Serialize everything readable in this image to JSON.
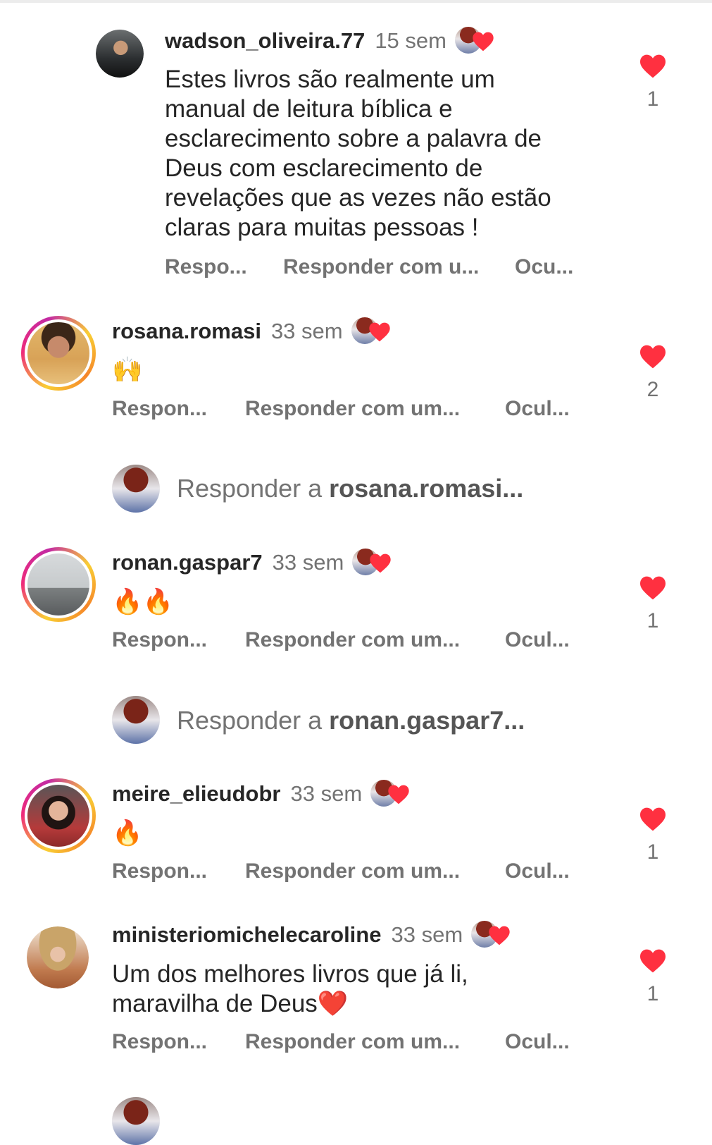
{
  "comments": [
    {
      "username": "wadson_oliveira.77",
      "time": "15 sem",
      "text_lines": [
        "Estes livros são realmente um",
        "manual de leitura bíblica e",
        "esclarecimento sobre a palavra de",
        "Deus com esclarecimento de",
        "revelações que as vezes não estão",
        "claras para muitas pessoas !"
      ],
      "actions": [
        "Respo...",
        "Responder com u...",
        "Ocu..."
      ],
      "likes": "1"
    },
    {
      "username": "rosana.romasi",
      "time": "33 sem",
      "text": "🙌",
      "actions": [
        "Respon...",
        "Responder com um...",
        "Ocul..."
      ],
      "likes": "2",
      "reply_prompt": {
        "prefix": "Responder a ",
        "name": "rosana.romasi..."
      }
    },
    {
      "username": "ronan.gaspar7",
      "time": "33 sem",
      "text": "🔥🔥",
      "actions": [
        "Respon...",
        "Responder com um...",
        "Ocul..."
      ],
      "likes": "1",
      "reply_prompt": {
        "prefix": "Responder a ",
        "name": "ronan.gaspar7..."
      }
    },
    {
      "username": "meire_elieudobr",
      "time": "33 sem",
      "text": "🔥",
      "actions": [
        "Respon...",
        "Responder com um...",
        "Ocul..."
      ],
      "likes": "1"
    },
    {
      "username": "ministeriomichelecaroline",
      "time": "33 sem",
      "text_lines": [
        "Um dos melhores livros que já li,",
        "maravilha de Deus❤️"
      ],
      "actions": [
        "Respon...",
        "Responder com um...",
        "Ocul..."
      ],
      "likes": "1"
    }
  ],
  "icons": {
    "like": "heart-icon",
    "creator_like": "creator-liked-heart-icon",
    "heart_color": "#ff3040"
  }
}
